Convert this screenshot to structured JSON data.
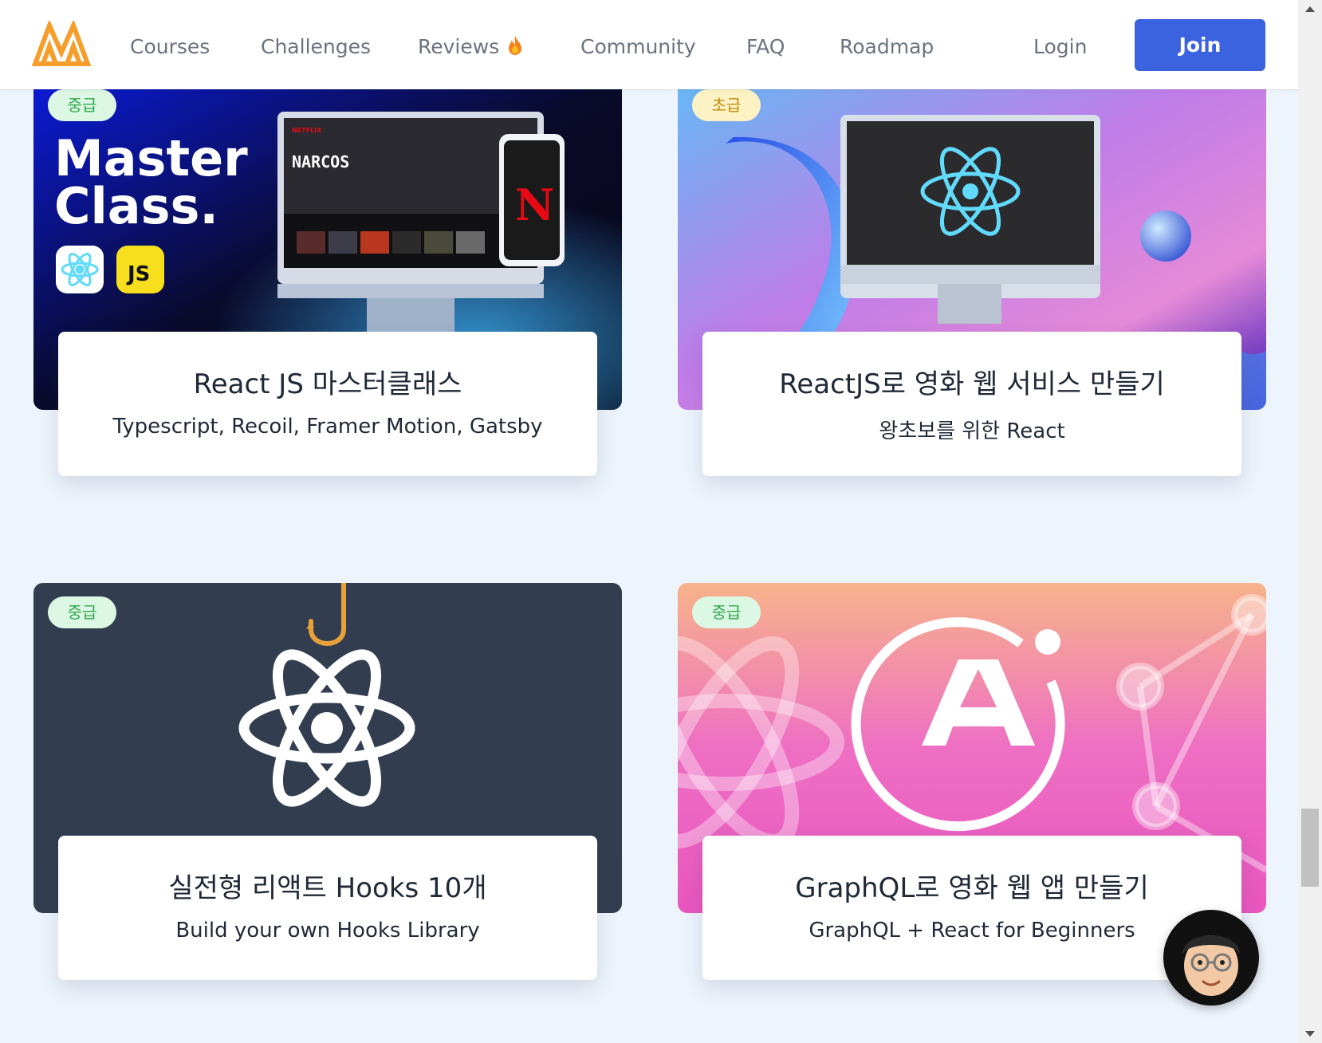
{
  "header": {
    "logo_name": "nomad-logo",
    "nav": [
      {
        "label": "Courses"
      },
      {
        "label": "Challenges"
      },
      {
        "label": "Reviews"
      },
      {
        "label": "Community"
      },
      {
        "label": "FAQ"
      },
      {
        "label": "Roadmap"
      }
    ],
    "login_label": "Login",
    "join_label": "Join"
  },
  "courses": [
    {
      "level": "중급",
      "image": {
        "headline_1": "Master",
        "headline_2": "Class.",
        "js_badge": "JS"
      },
      "title": "React JS 마스터클래스",
      "subtitle": "Typescript, Recoil, Framer Motion, Gatsby"
    },
    {
      "level": "초급",
      "title": "ReactJS로 영화 웹 서비스 만들기",
      "subtitle": "왕초보를 위한 React"
    },
    {
      "level": "중급",
      "title": "실전형 리액트 Hooks 10개",
      "subtitle": "Build your own Hooks Library"
    },
    {
      "level": "중급",
      "title": "GraphQL로 영화 웹 앱 만들기",
      "subtitle": "GraphQL + React for Beginners"
    }
  ],
  "colors": {
    "join_button": "#3b63e0",
    "badge_mid_bg": "#dcf7e3",
    "badge_mid_text": "#31a84f",
    "badge_low_bg": "#fdf2c4",
    "badge_low_text": "#c48a0b",
    "page_bg": "#eef4fc",
    "logo": "#f59e2b"
  },
  "icons": [
    "fire-icon",
    "react-icon",
    "apollo-icon",
    "fishhook-icon",
    "netflix-icon",
    "chat-avatar-icon"
  ]
}
